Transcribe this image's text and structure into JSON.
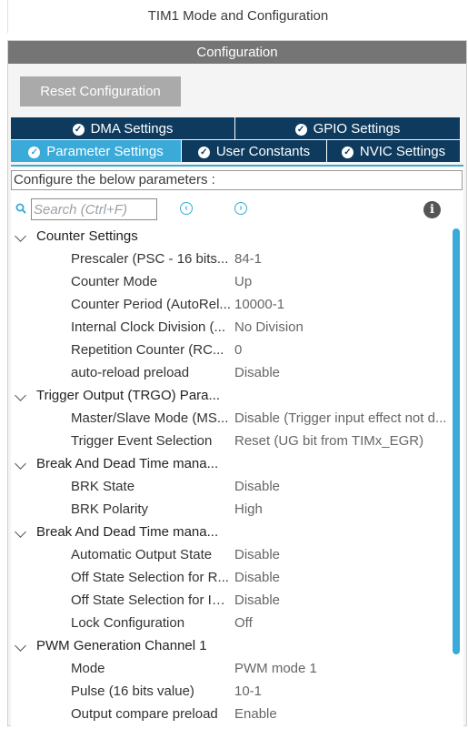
{
  "window": {
    "title": "TIM1 Mode and Configuration"
  },
  "configuration": {
    "header": "Configuration",
    "reset_label": "Reset Configuration",
    "tabs_row1": [
      {
        "label": "DMA Settings",
        "icon": "check-circle-icon"
      },
      {
        "label": "GPIO Settings",
        "icon": "check-circle-icon"
      }
    ],
    "tabs_row2": [
      {
        "label": "Parameter Settings",
        "icon": "check-circle-icon",
        "active": true
      },
      {
        "label": "User Constants",
        "icon": "check-circle-icon"
      },
      {
        "label": "NVIC Settings",
        "icon": "check-circle-icon"
      }
    ],
    "configure_label": "Configure the below parameters :",
    "search_placeholder": "Search (Ctrl+F)",
    "prev_icon": "chevron-left-circle-icon",
    "next_icon": "chevron-right-circle-icon",
    "info_icon": "info-icon"
  },
  "tree": [
    {
      "type": "group",
      "label": "Counter Settings"
    },
    {
      "type": "param",
      "name": "Prescaler (PSC - 16 bits...",
      "value": "84-1"
    },
    {
      "type": "param",
      "name": "Counter Mode",
      "value": "Up"
    },
    {
      "type": "param",
      "name": "Counter Period (AutoRel...",
      "value": "10000-1"
    },
    {
      "type": "param",
      "name": "Internal Clock Division (...",
      "value": "No Division"
    },
    {
      "type": "param",
      "name": "Repetition Counter (RC...",
      "value": "0"
    },
    {
      "type": "param",
      "name": "auto-reload preload",
      "value": "Disable"
    },
    {
      "type": "group",
      "label": "Trigger Output (TRGO) Para..."
    },
    {
      "type": "param",
      "name": "Master/Slave Mode (MS...",
      "value": "Disable (Trigger input effect not d..."
    },
    {
      "type": "param",
      "name": "Trigger Event Selection",
      "value": "Reset (UG bit from TIMx_EGR)"
    },
    {
      "type": "group",
      "label": "Break And Dead Time mana..."
    },
    {
      "type": "param",
      "name": "BRK State",
      "value": "Disable"
    },
    {
      "type": "param",
      "name": "BRK Polarity",
      "value": "High"
    },
    {
      "type": "group",
      "label": "Break And Dead Time mana..."
    },
    {
      "type": "param",
      "name": "Automatic Output State",
      "value": "Disable"
    },
    {
      "type": "param",
      "name": "Off State Selection for R...",
      "value": "Disable"
    },
    {
      "type": "param",
      "name": "Off State Selection for Idl...",
      "value": "Disable"
    },
    {
      "type": "param",
      "name": "Lock Configuration",
      "value": "Off"
    },
    {
      "type": "group",
      "label": "PWM Generation Channel 1"
    },
    {
      "type": "param",
      "name": "Mode",
      "value": "PWM mode 1"
    },
    {
      "type": "param",
      "name": "Pulse (16 bits value)",
      "value": "10-1"
    },
    {
      "type": "param",
      "name": "Output compare preload",
      "value": "Enable"
    }
  ],
  "colors": {
    "accent": "#3aaad9",
    "tab_dark": "#0e3a5e",
    "header_gray": "#757575"
  }
}
